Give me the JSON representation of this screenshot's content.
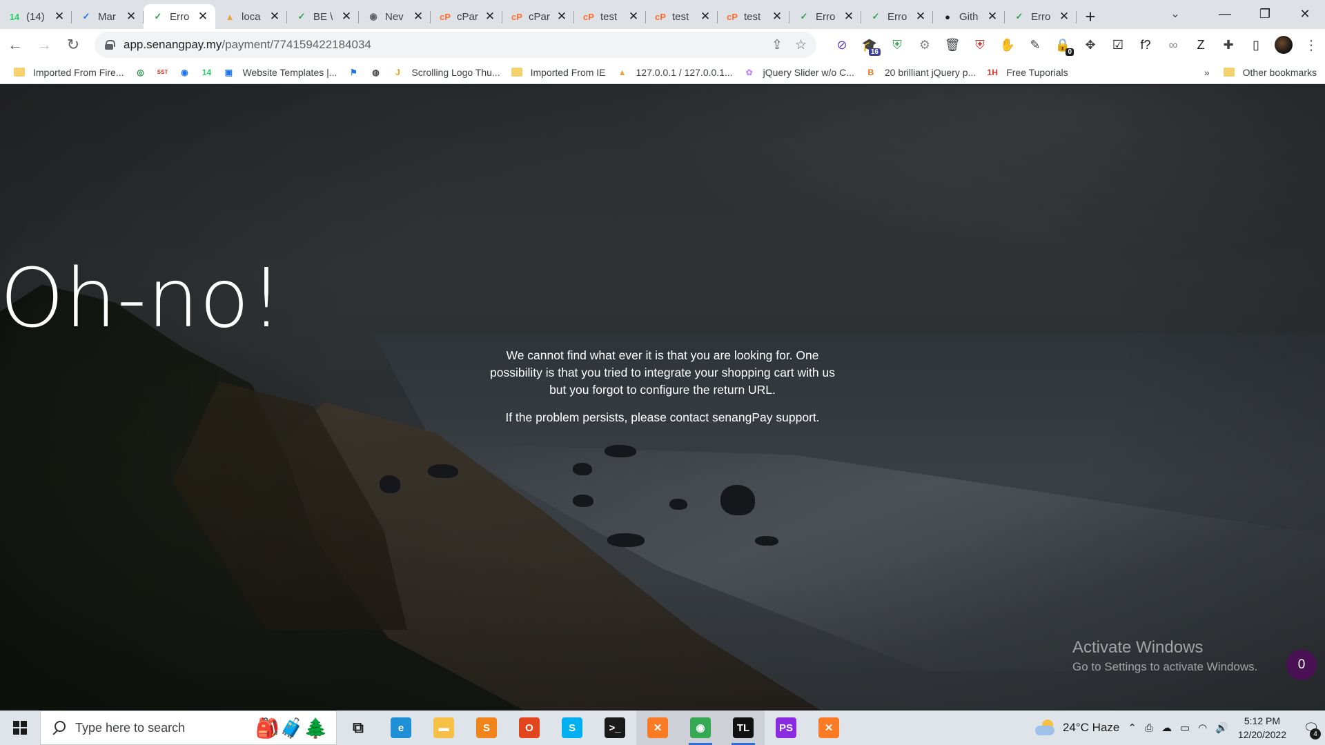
{
  "browser": {
    "tabs": [
      {
        "title": "(14)",
        "icon": "whatsapp-icon",
        "color": "#25d366",
        "glyph": "14"
      },
      {
        "title": "Mar",
        "icon": "checkmark-circle-icon",
        "color": "#1a73e8",
        "glyph": "✓"
      },
      {
        "title": "Erro",
        "icon": "green-check-icon",
        "color": "#2e9e4f",
        "glyph": "✓",
        "active": true
      },
      {
        "title": "loca",
        "icon": "phpmyadmin-icon",
        "color": "#e8a33d",
        "glyph": "▲"
      },
      {
        "title": "BE \\",
        "icon": "green-check-icon",
        "color": "#2e9e4f",
        "glyph": "✓"
      },
      {
        "title": "Nev",
        "icon": "chrome-icon",
        "color": "#5f6368",
        "glyph": "◉"
      },
      {
        "title": "cPar",
        "icon": "cpanel-icon",
        "color": "#ff6c2c",
        "glyph": "cP"
      },
      {
        "title": "cPar",
        "icon": "cpanel-icon",
        "color": "#ff6c2c",
        "glyph": "cP"
      },
      {
        "title": "test",
        "icon": "cpanel-icon",
        "color": "#ff6c2c",
        "glyph": "cP"
      },
      {
        "title": "test",
        "icon": "cpanel-icon",
        "color": "#ff6c2c",
        "glyph": "cP"
      },
      {
        "title": "test",
        "icon": "cpanel-icon",
        "color": "#ff6c2c",
        "glyph": "cP"
      },
      {
        "title": "Erro",
        "icon": "green-check-icon",
        "color": "#2e9e4f",
        "glyph": "✓"
      },
      {
        "title": "Erro",
        "icon": "green-check-icon",
        "color": "#2e9e4f",
        "glyph": "✓"
      },
      {
        "title": "Gith",
        "icon": "github-icon",
        "color": "#1a1a1a",
        "glyph": "●"
      },
      {
        "title": "Erro",
        "icon": "green-check-icon",
        "color": "#2e9e4f",
        "glyph": "✓"
      }
    ],
    "url_host": "app.senangpay.my",
    "url_path": "/payment/774159422184034",
    "extensions": [
      {
        "icon": "blocker-icon",
        "color": "#5f3dc4",
        "glyph": "⊘"
      },
      {
        "icon": "graduation-cap-icon",
        "color": "#3b3f9a",
        "glyph": "🎓",
        "badge": "16",
        "badge_color": "#3b3f9a"
      },
      {
        "icon": "shield-check-icon",
        "color": "#34a853",
        "glyph": "⛨"
      },
      {
        "icon": "gear-icon",
        "color": "#80868b",
        "glyph": "⚙"
      },
      {
        "icon": "trash-icon",
        "color": "#3c4043",
        "glyph": "🗑"
      },
      {
        "icon": "lock-shield-icon",
        "color": "#d93025",
        "glyph": "⛨"
      },
      {
        "icon": "stop-hand-icon",
        "color": "#d93025",
        "glyph": "✋"
      },
      {
        "icon": "eyedropper-icon",
        "color": "#3c4043",
        "glyph": "✎"
      },
      {
        "icon": "lock-badge-icon",
        "color": "#1a73e8",
        "glyph": "🔒",
        "badge": "0",
        "badge_color": "#1a1a1a"
      },
      {
        "icon": "move-icon",
        "color": "#3c4043",
        "glyph": "✥"
      },
      {
        "icon": "checkbox-icon",
        "color": "#1a1a1a",
        "glyph": "☑"
      },
      {
        "icon": "font-finder-icon",
        "color": "#1a1a1a",
        "glyph": "f?"
      },
      {
        "icon": "link-icon",
        "color": "#80868b",
        "glyph": "∞"
      },
      {
        "icon": "z-icon",
        "color": "#1a1a1a",
        "glyph": "Z"
      },
      {
        "icon": "puzzle-icon",
        "color": "#3c4043",
        "glyph": "✚"
      },
      {
        "icon": "sidepanel-icon",
        "color": "#1a1a1a",
        "glyph": "▯"
      }
    ],
    "bookmarks": [
      {
        "label": "Imported From Fire...",
        "icon": "folder-icon",
        "type": "folder"
      },
      {
        "label": "",
        "icon": "spiral-icon",
        "color": "#1e8e3e",
        "glyph": "◎"
      },
      {
        "label": "",
        "icon": "sst-icon",
        "color": "#d93025",
        "glyph": "SST"
      },
      {
        "label": "",
        "icon": "pin-icon",
        "color": "#1a73e8",
        "glyph": "◉"
      },
      {
        "label": "",
        "icon": "whatsapp-icon",
        "color": "#25d366",
        "glyph": "14"
      },
      {
        "label": "Website Templates |...",
        "icon": "template-icon",
        "color": "#1a73e8",
        "glyph": "▣"
      },
      {
        "label": "",
        "icon": "flag-icon",
        "color": "#1a73e8",
        "glyph": "⚑"
      },
      {
        "label": "",
        "icon": "globe-icon",
        "color": "#3c4043",
        "glyph": "◍"
      },
      {
        "label": "Scrolling Logo Thu...",
        "icon": "j-icon",
        "color": "#f29900",
        "glyph": "J"
      },
      {
        "label": "Imported From IE",
        "icon": "folder-icon",
        "type": "folder"
      },
      {
        "label": "127.0.0.1 / 127.0.0.1...",
        "icon": "phpmyadmin-icon",
        "color": "#e8a33d",
        "glyph": "▲"
      },
      {
        "label": "jQuery Slider w/o C...",
        "icon": "slider-icon",
        "color": "#c58af9",
        "glyph": "✿"
      },
      {
        "label": "20 brilliant jQuery p...",
        "icon": "jquery-p-icon",
        "color": "#e8710a",
        "glyph": "B"
      },
      {
        "label": "Free Tuporials",
        "icon": "1h-icon",
        "color": "#d93025",
        "glyph": "1H"
      }
    ],
    "bookmarks_more": "»",
    "other_bookmarks": "Other bookmarks"
  },
  "page": {
    "headline": "Oh-no!",
    "message": "We cannot find what ever it is that you are looking for. One possibility is that you tried to integrate your shopping cart with us but you forgot to configure the return URL.",
    "support": "If the problem persists, please contact senangPay support.",
    "chat_count": "0"
  },
  "watermark": {
    "title": "Activate Windows",
    "subtitle": "Go to Settings to activate Windows."
  },
  "taskbar": {
    "search_placeholder": "Type here to search",
    "apps": [
      {
        "icon": "task-view-icon",
        "color": "#1a1a1a",
        "glyph": "⧉",
        "text_icon": true
      },
      {
        "icon": "edge-icon",
        "color": "#1f8fd6",
        "glyph": "e"
      },
      {
        "icon": "file-explorer-icon",
        "color": "#f5c043",
        "glyph": "▬"
      },
      {
        "icon": "sublime-text-icon",
        "color": "#f0841a",
        "glyph": "S"
      },
      {
        "icon": "office-icon",
        "color": "#e3461d",
        "glyph": "O"
      },
      {
        "icon": "skype-icon",
        "color": "#00aff0",
        "glyph": "S"
      },
      {
        "icon": "terminal-icon",
        "color": "#1a1a1a",
        "glyph": ">_"
      },
      {
        "icon": "xampp-icon",
        "color": "#fb7a24",
        "glyph": "✕",
        "open": true
      },
      {
        "icon": "chrome-icon",
        "color": "#34a853",
        "glyph": "◉",
        "open": true,
        "active": true
      },
      {
        "icon": "trello-tl-icon",
        "color": "#111111",
        "glyph": "TL",
        "open": true,
        "active": true
      },
      {
        "icon": "phpstorm-icon",
        "color": "#8a2be2",
        "glyph": "PS"
      },
      {
        "icon": "xampp-icon",
        "color": "#fb7a24",
        "glyph": "✕"
      }
    ],
    "weather_temp": "24°C",
    "weather_desc": "Haze",
    "time": "5:12 PM",
    "date": "12/20/2022",
    "notification_count": "4"
  }
}
